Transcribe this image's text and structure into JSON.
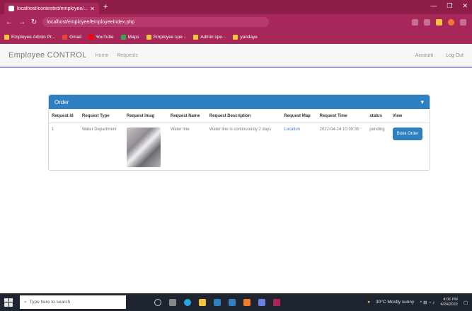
{
  "browser": {
    "tab_title": "localhost/contested/employee/...",
    "address": "localhost/employee/EmployeeIndex.php",
    "bookmarks": [
      "Employee Admin Pr...",
      "Gmail",
      "YouTube",
      "Maps",
      "Employee spe...",
      "Admin spe...",
      "yandaye"
    ]
  },
  "app": {
    "brand": "Employee CONTROL",
    "nav_links": [
      "Home",
      "Requests"
    ],
    "nav_right": [
      "Account",
      "Log Out"
    ]
  },
  "panel": {
    "title": "Order",
    "toggle_icon": "chevron-down-icon",
    "headers": [
      "Request Id",
      "Request Type",
      "Request Imag",
      "Request Name",
      "Request Description",
      "Request Map",
      "Request Time",
      "status",
      "View"
    ],
    "row": {
      "id": "1",
      "type": "Water Department",
      "name": "Water line",
      "description": "Water line is continuously 2 days",
      "map": "Location",
      "time": "2022-04-24 10:30:35",
      "status": "pending",
      "view_label": "Book Order"
    }
  },
  "taskbar": {
    "search_placeholder": "Type here to search",
    "weather": "30°C Mostly sunny",
    "time": "4:06 PM",
    "date": "4/24/2022"
  },
  "colors": {
    "browser_frame": "#a8275b",
    "accent": "#2f7fc1",
    "nav_underline": "#9b9fd0"
  }
}
